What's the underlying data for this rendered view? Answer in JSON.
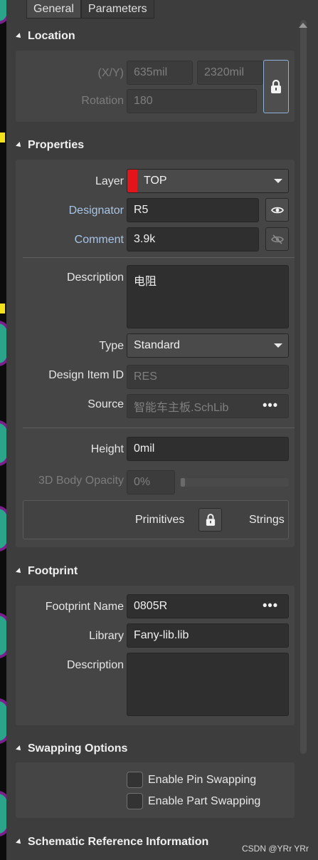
{
  "tabs": [
    "General",
    "Parameters"
  ],
  "sections": {
    "location": "Location",
    "properties": "Properties",
    "footprint": "Footprint",
    "swapping": "Swapping Options",
    "schematic": "Schematic Reference Information"
  },
  "location": {
    "xy_label": "(X/Y)",
    "x_value": "635mil",
    "y_value": "2320mil",
    "rotation_label": "Rotation",
    "rotation_value": "180"
  },
  "properties": {
    "layer_label": "Layer",
    "layer_value": "TOP",
    "layer_color": "#e3151a",
    "designator_label": "Designator",
    "designator_value": "R5",
    "comment_label": "Comment",
    "comment_value": "3.9k",
    "description_label": "Description",
    "description_value": "电阻",
    "type_label": "Type",
    "type_value": "Standard",
    "design_item_label": "Design Item ID",
    "design_item_value": "RES",
    "source_label": "Source",
    "source_value": "智能车主板.SchLib",
    "height_label": "Height",
    "height_value": "0mil",
    "opacity_label": "3D Body Opacity",
    "opacity_value": "0%",
    "primitives_label": "Primitives",
    "strings_label": "Strings"
  },
  "footprint": {
    "name_label": "Footprint Name",
    "name_value": "0805R",
    "library_label": "Library",
    "library_value": "Fany-lib.lib",
    "description_label": "Description",
    "description_value": ""
  },
  "swapping": {
    "pin": "Enable Pin Swapping",
    "part": "Enable Part Swapping"
  },
  "watermark": "CSDN @YRr YRr"
}
